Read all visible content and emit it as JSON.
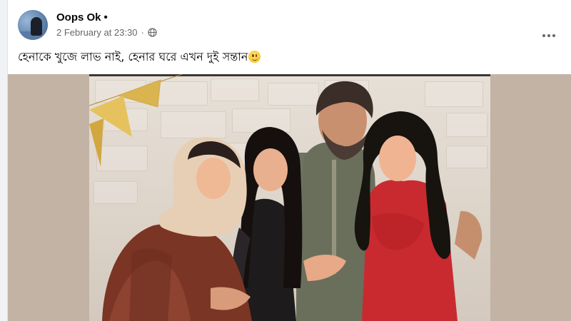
{
  "post": {
    "author": "Oops Ok",
    "author_separator": "•",
    "timestamp": "2 February at 23:30",
    "meta_separator": "·",
    "audience_icon": "globe-icon",
    "more_icon": "more-options-icon",
    "caption_text": "হেনাকে খুজে লাভ নাই, হেনার ঘরে এখন দুই সন্তান",
    "caption_emoji": "slightly-smiling-face-icon"
  },
  "media": {
    "kind": "photo"
  },
  "colors": {
    "primary_text": "#050505",
    "secondary_text": "#65676b",
    "page_background": "#f0f2f5",
    "card_background": "#ffffff",
    "media_letterbox": "#c3b3a4"
  }
}
